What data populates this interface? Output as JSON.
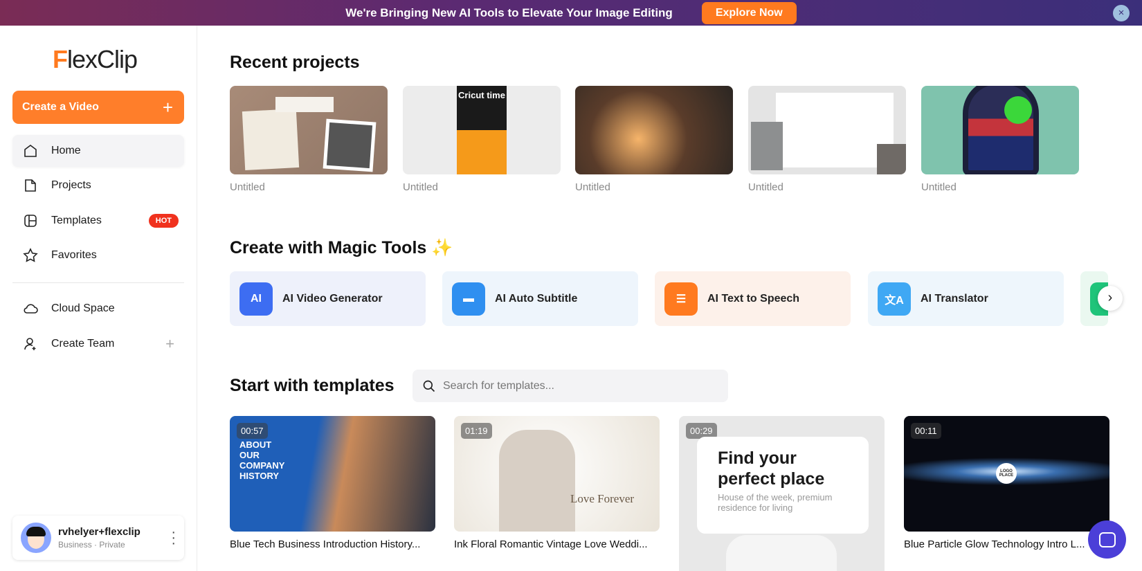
{
  "banner": {
    "text": "We're Bringing New AI Tools to Elevate Your Image Editing",
    "button": "Explore Now",
    "close": "×"
  },
  "sidebar": {
    "logo": "FlexClip",
    "create_button": "Create a Video",
    "create_plus": "+",
    "items": [
      {
        "label": "Home",
        "icon": "home-icon"
      },
      {
        "label": "Projects",
        "icon": "projects-icon"
      },
      {
        "label": "Templates",
        "icon": "templates-icon",
        "badge": "HOT"
      },
      {
        "label": "Favorites",
        "icon": "star-icon"
      },
      {
        "label": "Cloud Space",
        "icon": "cloud-icon"
      },
      {
        "label": "Create Team",
        "icon": "add-user-icon",
        "action": "+"
      }
    ],
    "user": {
      "name": "rvhelyer+flexclip",
      "plan": "Business · Private"
    }
  },
  "recent": {
    "title": "Recent projects",
    "items": [
      {
        "label": "Untitled",
        "thumb_text": ""
      },
      {
        "label": "Untitled",
        "thumb_text": "Cricut time"
      },
      {
        "label": "Untitled",
        "thumb_text": ""
      },
      {
        "label": "Untitled",
        "thumb_text": ""
      },
      {
        "label": "Untitled",
        "thumb_text": ""
      }
    ]
  },
  "magic": {
    "title": "Create with Magic Tools",
    "items": [
      {
        "label": "AI Video Generator",
        "icon_text": "AI",
        "color": "#3d6df2",
        "bg": "#eef1fb"
      },
      {
        "label": "AI Auto Subtitle",
        "icon_text": "▬",
        "color": "#2f8ff0",
        "bg": "#eef5fc"
      },
      {
        "label": "AI Text to Speech",
        "icon_text": "☰",
        "color": "#ff7a1f",
        "bg": "#fdf1ea"
      },
      {
        "label": "AI Translator",
        "icon_text": "文A",
        "color": "#3fa8f4",
        "bg": "#eef6fc"
      }
    ]
  },
  "templates": {
    "title": "Start with templates",
    "search_placeholder": "Search for templates...",
    "items": [
      {
        "duration": "00:57",
        "label": "Blue Tech Business Introduction History...",
        "thumb_text": "ABOUT OUR COMPANY HISTORY"
      },
      {
        "duration": "01:19",
        "label": "Ink Floral Romantic Vintage Love Weddi...",
        "thumb_text": "Love Forever"
      },
      {
        "duration": "00:29",
        "label": "",
        "thumb_text": "Find your perfect place",
        "thumb_sub": "House of the week, premium residence for living"
      },
      {
        "duration": "00:11",
        "label": "Blue Particle Glow Technology Intro L...",
        "thumb_text": "LOGO PLACE"
      }
    ]
  },
  "colors": {
    "accent": "#ff7e2a",
    "hot": "#f0321e",
    "chat": "#4b3fd8"
  }
}
